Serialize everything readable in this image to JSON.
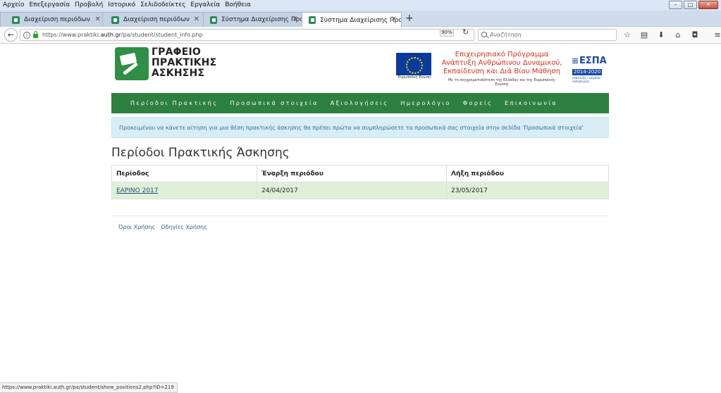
{
  "menubar": {
    "items": [
      "Αρχείο",
      "Επεξεργασία",
      "Προβολή",
      "Ιστορικό",
      "Σελιδοδείκτες",
      "Εργαλεία",
      "Βοήθεια"
    ]
  },
  "window_controls": {
    "minimize": "–",
    "maximize": "□",
    "close": "✕"
  },
  "tabs": [
    {
      "title": "Διαχείριση περιόδων"
    },
    {
      "title": "Διαχείριση περιόδων"
    },
    {
      "title": "Σύστημα Διαχείρισης Πρα..."
    },
    {
      "title": "Σύστημα Διαχείρισης Πρα..."
    }
  ],
  "navbar": {
    "url_prefix": "https://www.praktiki.",
    "url_domain": "auth.gr",
    "url_path": "/pa/student/student_info.php",
    "zoom": "90%",
    "search_placeholder": "Αναζήτηση"
  },
  "header": {
    "logo_lines": [
      "ΓΡΑΦΕΙΟ",
      "ΠΡΑΚΤΙΚΗΣ",
      "ΑΣΚΗΣΗΣ"
    ],
    "eu_caption": "Ευρωπαϊκή Ένωση",
    "program_lines": [
      "Επιχειρησιακό Πρόγραμμα",
      "Ανάπτυξη Ανθρώπινου Δυναμικού,",
      "Εκπαίδευση και Διά Βίου Μάθηση"
    ],
    "program_sub": "Με τη συγχρηματοδότηση της Ελλάδας και της Ευρωπαϊκής Ένωσης",
    "espa_text": "ΕΣΠΑ",
    "espa_years": "2014-2020",
    "espa_words": "ανάπτυξη - εργασία - αλληλεγγύη"
  },
  "main_nav": {
    "items": [
      "Περίοδοι Πρακτικής",
      "Προσωπικά στοιχεία",
      "Αξιολογήσεις",
      "Ημερολόγιο",
      "Φορείς",
      "Επικοινωνία"
    ]
  },
  "alert": {
    "text": "Προκειμένου να κάνετε αίτηση για μια θέση πρακτικής άσκησης θα πρέπει πρώτα να συμπληρώσετε τα προσωπικά σας στοιχεία στην σελίδα 'Προσωπικά στοιχεία'"
  },
  "page_title": "Περίοδοι Πρακτικής Άσκησης",
  "periods_table": {
    "columns": [
      "Περίοδος",
      "Έναρξη περιόδου",
      "Λήξη περιόδου"
    ],
    "rows": [
      {
        "period": "ΕΑΡΙΝΟ 2017",
        "start": "24/04/2017",
        "end": "23/05/2017"
      }
    ]
  },
  "footer": {
    "links": [
      "Όροι Χρήσης",
      "Οδηγίες Χρήσης"
    ]
  },
  "status_bar": {
    "url": "https://www.praktiki.auth.gr/pa/student/show_positions2.php?ID=219"
  }
}
